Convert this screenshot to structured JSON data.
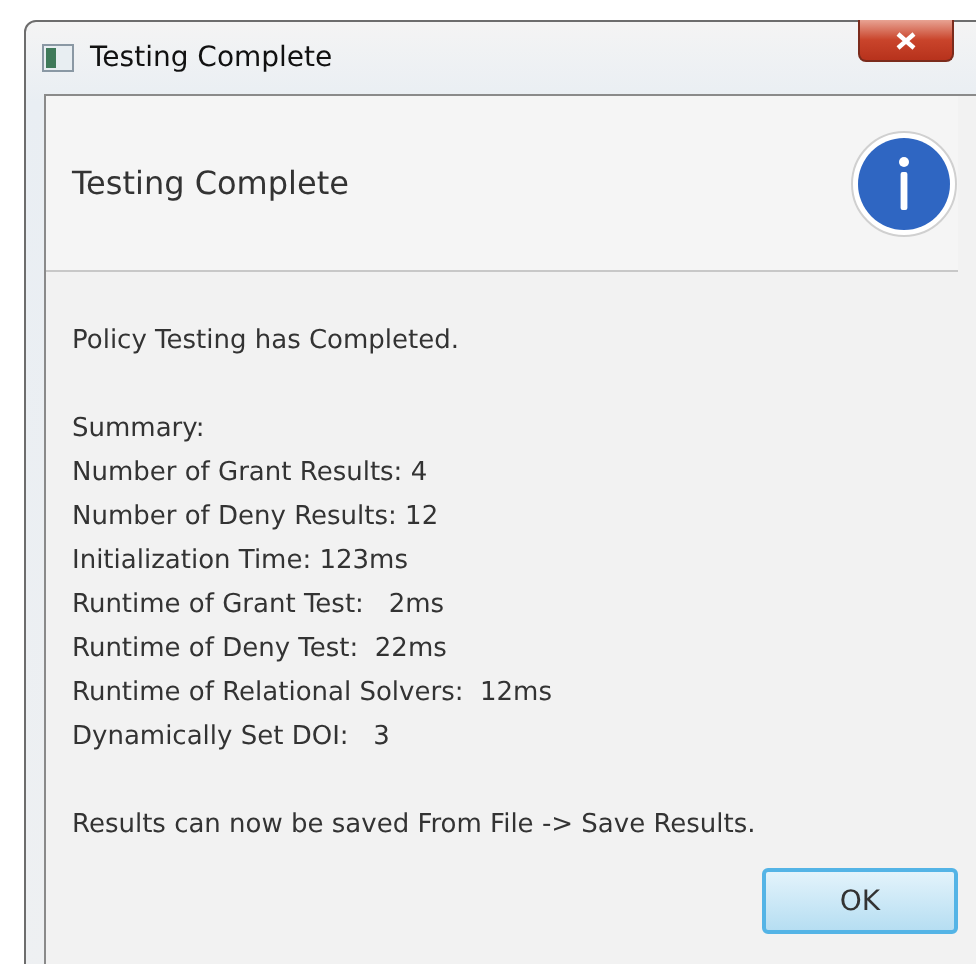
{
  "window": {
    "title": "Testing Complete"
  },
  "header": {
    "title": "Testing Complete"
  },
  "body": {
    "paragraphs": [
      [
        "Policy Testing has Completed."
      ],
      [
        "Summary:",
        "Number of Grant Results: 4",
        "Number of Deny Results: 12",
        "Initialization Time: 123ms",
        "Runtime of Grant Test:   2ms",
        "Runtime of Deny Test:  22ms",
        "Runtime of Relational Solvers:  12ms",
        "Dynamically Set DOI:   3"
      ],
      [
        "Results can now be saved From File -> Save Results."
      ]
    ]
  },
  "buttons": [
    {
      "label": "OK",
      "default": true
    }
  ]
}
